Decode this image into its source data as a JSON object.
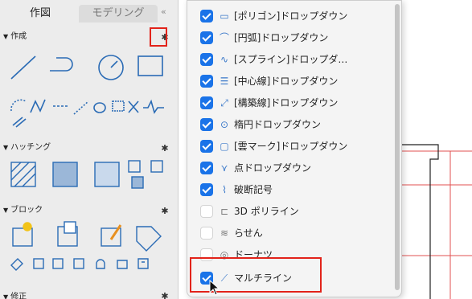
{
  "palette": {
    "tabs": {
      "active": "作図",
      "inactive": "モデリング",
      "collapse": "«"
    },
    "sections": [
      {
        "label": "作成"
      },
      {
        "label": "ハッチング"
      },
      {
        "label": "ブロック"
      },
      {
        "label": "修正"
      }
    ],
    "gear_icon": "gear-icon"
  },
  "menu": {
    "items": [
      {
        "label": "[ポリゴン]ドロップダウン",
        "checked": true,
        "icon": "polygon-icon"
      },
      {
        "label": "[円弧]ドロップダウン",
        "checked": true,
        "icon": "arc-icon"
      },
      {
        "label": "[スプライン]ドロップダ…",
        "checked": true,
        "icon": "spline-icon"
      },
      {
        "label": "[中心線]ドロップダウン",
        "checked": true,
        "icon": "centerline-icon"
      },
      {
        "label": "[構築線]ドロップダウン",
        "checked": true,
        "icon": "construction-line-icon"
      },
      {
        "label": "楕円ドロップダウン",
        "checked": true,
        "icon": "ellipse-icon"
      },
      {
        "label": "[雲マーク]ドロップダウン",
        "checked": true,
        "icon": "revision-cloud-icon"
      },
      {
        "label": "点ドロップダウン",
        "checked": true,
        "icon": "point-icon"
      },
      {
        "label": "破断記号",
        "checked": true,
        "icon": "breakline-icon"
      },
      {
        "label": "3D ポリライン",
        "checked": false,
        "icon": "3d-polyline-icon"
      },
      {
        "label": "らせん",
        "checked": false,
        "icon": "helix-icon"
      },
      {
        "label": "ドーナツ",
        "checked": false,
        "icon": "donut-icon"
      },
      {
        "label": "マルチライン",
        "checked": true,
        "icon": "multiline-icon"
      }
    ]
  },
  "colors": {
    "accent": "#1a73e8",
    "highlight": "#e2231a",
    "tool_blue": "#2a6bb5",
    "drawing_red": "#e05050"
  }
}
